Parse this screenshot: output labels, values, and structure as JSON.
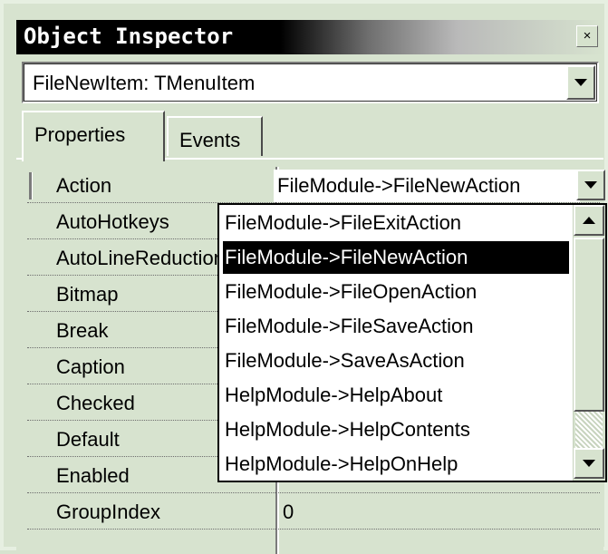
{
  "window": {
    "title": "Object Inspector",
    "close_glyph": "×"
  },
  "component_selector": {
    "value": "FileNewItem: TMenuItem"
  },
  "tabs": [
    {
      "label": "Properties",
      "active": true
    },
    {
      "label": "Events",
      "active": false
    }
  ],
  "properties": [
    {
      "name": "Action",
      "value": ""
    },
    {
      "name": "AutoHotkeys",
      "value": ""
    },
    {
      "name": "AutoLineReduction",
      "value": ""
    },
    {
      "name": "Bitmap",
      "value": ""
    },
    {
      "name": "Break",
      "value": ""
    },
    {
      "name": "Caption",
      "value": ""
    },
    {
      "name": "Checked",
      "value": ""
    },
    {
      "name": "Default",
      "value": ""
    },
    {
      "name": "Enabled",
      "value": "true"
    },
    {
      "name": "GroupIndex",
      "value": "0"
    }
  ],
  "action_editor": {
    "value": "FileModule->FileNewAction"
  },
  "action_dropdown": {
    "items": [
      "FileModule->FileExitAction",
      "FileModule->FileNewAction",
      "FileModule->FileOpenAction",
      "FileModule->FileSaveAction",
      "FileModule->SaveAsAction",
      "HelpModule->HelpAbout",
      "HelpModule->HelpContents",
      "HelpModule->HelpOnHelp"
    ],
    "selected_index": 1
  },
  "colors": {
    "face": "#d7e3cf",
    "title_start": "#000000",
    "selection": "#000000"
  }
}
